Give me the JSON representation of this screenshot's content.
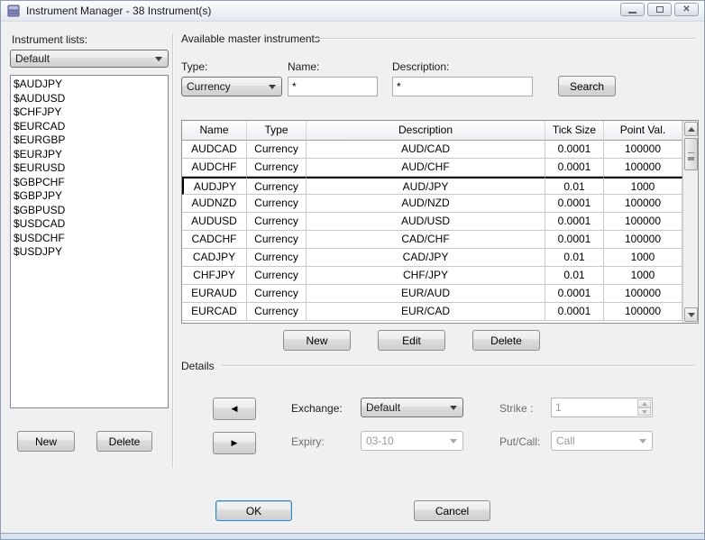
{
  "window": {
    "title": "Instrument Manager - 38 Instrument(s)"
  },
  "left_panel": {
    "label": "Instrument lists:",
    "selected_list": "Default",
    "instruments": [
      "$AUDJPY",
      "$AUDUSD",
      "$CHFJPY",
      "$EURCAD",
      "$EURGBP",
      "$EURJPY",
      "$EURUSD",
      "$GBPCHF",
      "$GBPJPY",
      "$GBPUSD",
      "$USDCAD",
      "$USDCHF",
      "$USDJPY"
    ],
    "new_label": "New",
    "delete_label": "Delete"
  },
  "right_panel": {
    "group_title": "Available master instruments",
    "filters": {
      "type_label": "Type:",
      "type_value": "Currency",
      "name_label": "Name:",
      "name_value": "*",
      "description_label": "Description:",
      "description_value": "*",
      "search_label": "Search"
    },
    "table": {
      "columns": [
        "Name",
        "Type",
        "Description",
        "Tick Size",
        "Point Val."
      ],
      "rows": [
        {
          "name": "AUDCAD",
          "type": "Currency",
          "description": "AUD/CAD",
          "tick_size": "0.0001",
          "point_val": "100000"
        },
        {
          "name": "AUDCHF",
          "type": "Currency",
          "description": "AUD/CHF",
          "tick_size": "0.0001",
          "point_val": "100000"
        },
        {
          "name": "AUDJPY",
          "type": "Currency",
          "description": "AUD/JPY",
          "tick_size": "0.01",
          "point_val": "1000"
        },
        {
          "name": "AUDNZD",
          "type": "Currency",
          "description": "AUD/NZD",
          "tick_size": "0.0001",
          "point_val": "100000"
        },
        {
          "name": "AUDUSD",
          "type": "Currency",
          "description": "AUD/USD",
          "tick_size": "0.0001",
          "point_val": "100000"
        },
        {
          "name": "CADCHF",
          "type": "Currency",
          "description": "CAD/CHF",
          "tick_size": "0.0001",
          "point_val": "100000"
        },
        {
          "name": "CADJPY",
          "type": "Currency",
          "description": "CAD/JPY",
          "tick_size": "0.01",
          "point_val": "1000"
        },
        {
          "name": "CHFJPY",
          "type": "Currency",
          "description": "CHF/JPY",
          "tick_size": "0.01",
          "point_val": "1000"
        },
        {
          "name": "EURAUD",
          "type": "Currency",
          "description": "EUR/AUD",
          "tick_size": "0.0001",
          "point_val": "100000"
        },
        {
          "name": "EURCAD",
          "type": "Currency",
          "description": "EUR/CAD",
          "tick_size": "0.0001",
          "point_val": "100000"
        }
      ],
      "selected_row": "AUDJPY"
    },
    "actions": {
      "new_label": "New",
      "edit_label": "Edit",
      "delete_label": "Delete"
    }
  },
  "details": {
    "title": "Details",
    "exchange_label": "Exchange:",
    "exchange_value": "Default",
    "expiry_label": "Expiry:",
    "expiry_value": "03-10",
    "strike_label": "Strike :",
    "strike_value": "1",
    "putcall_label": "Put/Call:",
    "putcall_value": "Call"
  },
  "footer": {
    "ok_label": "OK",
    "cancel_label": "Cancel"
  },
  "colors": {
    "selection_blue": "#cbe4f8",
    "focus_accent": "#3c7fb1",
    "window_bg": "#f0f0f0",
    "frame_strip": "#dae3f0"
  }
}
